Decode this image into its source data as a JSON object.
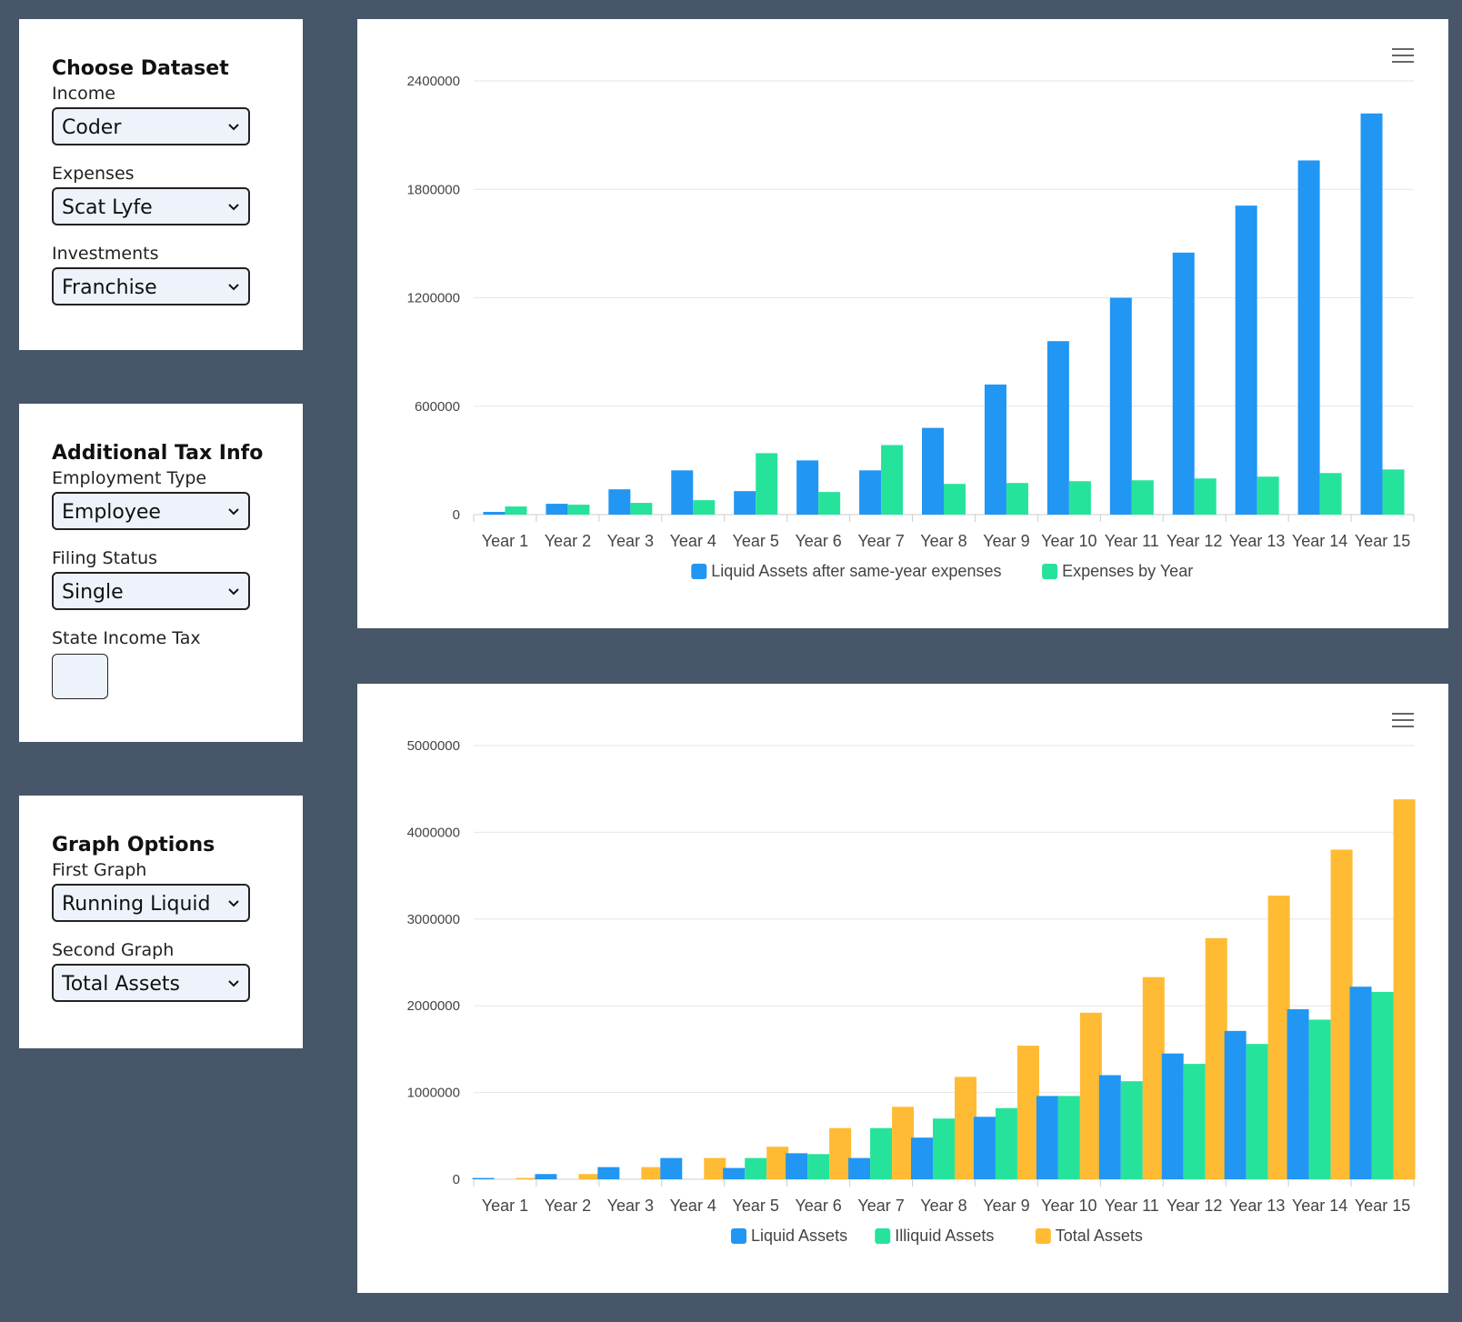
{
  "dataset_panel": {
    "title": "Choose Dataset",
    "income_label": "Income",
    "income_value": "Coder",
    "expenses_label": "Expenses",
    "expenses_value": "Scat Lyfe",
    "investments_label": "Investments",
    "investments_value": "Franchise"
  },
  "tax_panel": {
    "title": "Additional Tax Info",
    "employment_label": "Employment Type",
    "employment_value": "Employee",
    "filing_label": "Filing Status",
    "filing_value": "Single",
    "state_tax_label": "State Income Tax",
    "state_tax_value": ""
  },
  "graph_panel": {
    "title": "Graph Options",
    "first_label": "First Graph",
    "first_value": "Running Liquid Assets",
    "second_label": "Second Graph",
    "second_value": "Total Assets"
  },
  "chart_data": [
    {
      "type": "bar",
      "categories": [
        "Year 1",
        "Year 2",
        "Year 3",
        "Year 4",
        "Year 5",
        "Year 6",
        "Year 7",
        "Year 8",
        "Year 9",
        "Year 10",
        "Year 11",
        "Year 12",
        "Year 13",
        "Year 14",
        "Year 15"
      ],
      "y_ticks": [
        "2400000",
        "1800000",
        "1200000",
        "600000",
        "0"
      ],
      "ylim": [
        0,
        2400000
      ],
      "legend_position": "bottom",
      "grid": true,
      "series": [
        {
          "name": "Liquid Assets after same-year expenses",
          "color": "#2196f3",
          "values": [
            15000,
            60000,
            140000,
            245000,
            130000,
            300000,
            245000,
            480000,
            720000,
            960000,
            1200000,
            1450000,
            1710000,
            1960000,
            2220000
          ]
        },
        {
          "name": "Expenses by Year",
          "color": "#26e39b",
          "values": [
            45000,
            55000,
            65000,
            80000,
            340000,
            125000,
            385000,
            170000,
            175000,
            185000,
            190000,
            200000,
            210000,
            230000,
            250000
          ]
        }
      ]
    },
    {
      "type": "bar",
      "categories": [
        "Year 1",
        "Year 2",
        "Year 3",
        "Year 4",
        "Year 5",
        "Year 6",
        "Year 7",
        "Year 8",
        "Year 9",
        "Year 10",
        "Year 11",
        "Year 12",
        "Year 13",
        "Year 14",
        "Year 15"
      ],
      "y_ticks": [
        "5000000",
        "4000000",
        "3000000",
        "2000000",
        "1000000",
        "0"
      ],
      "ylim": [
        0,
        5000000
      ],
      "legend_position": "bottom",
      "grid": true,
      "series": [
        {
          "name": "Liquid Assets",
          "color": "#2196f3",
          "values": [
            15000,
            60000,
            140000,
            245000,
            130000,
            300000,
            245000,
            480000,
            720000,
            960000,
            1200000,
            1450000,
            1710000,
            1960000,
            2220000
          ]
        },
        {
          "name": "Illiquid Assets",
          "color": "#26e39b",
          "values": [
            0,
            0,
            0,
            0,
            245000,
            290000,
            590000,
            700000,
            820000,
            960000,
            1130000,
            1330000,
            1560000,
            1840000,
            2160000
          ]
        },
        {
          "name": "Total Assets",
          "color": "#ffbb33",
          "values": [
            15000,
            60000,
            140000,
            245000,
            375000,
            590000,
            835000,
            1180000,
            1540000,
            1920000,
            2330000,
            2780000,
            3270000,
            3800000,
            4380000
          ]
        }
      ]
    }
  ]
}
